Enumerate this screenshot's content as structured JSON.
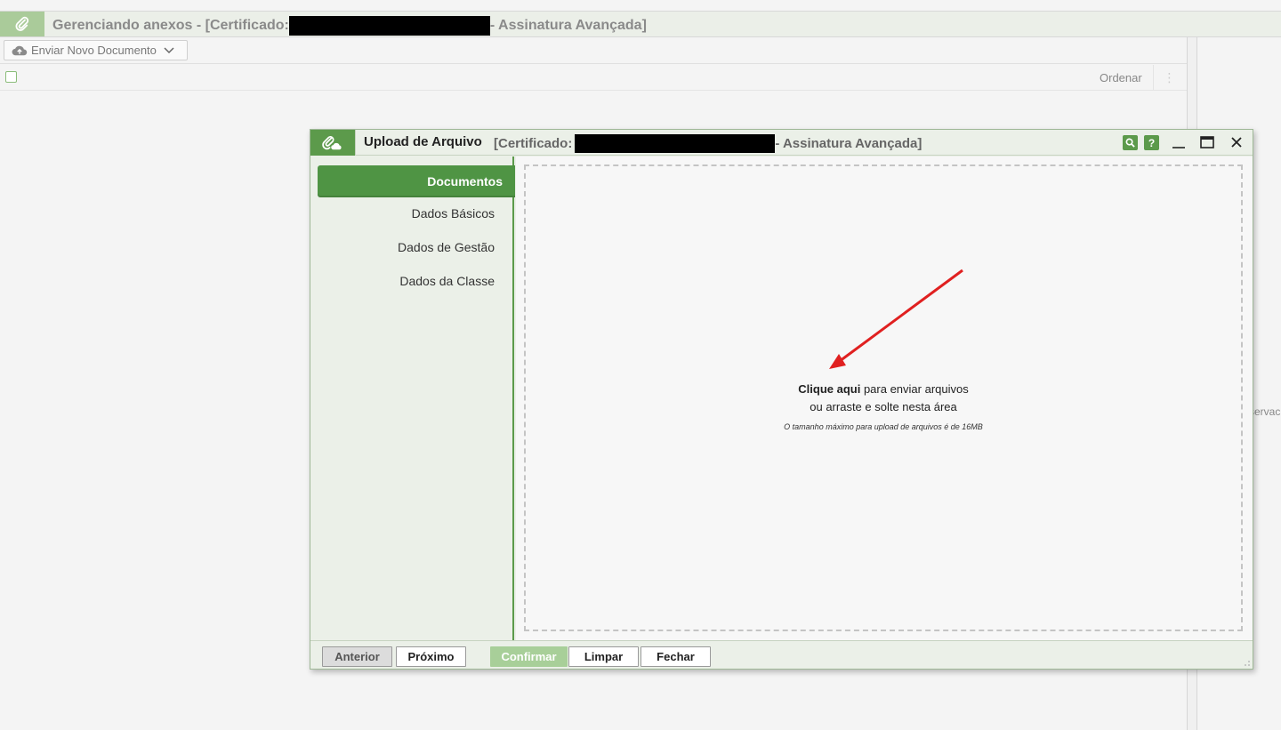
{
  "background_window": {
    "title_prefix": "Gerenciando anexos - [Certificado:",
    "title_suffix": "- Assinatura Avançada]",
    "send_button_label": "Enviar Novo Documento",
    "sort_label": "Ordenar",
    "partial_side_text": "servac"
  },
  "dialog": {
    "title": "Upload de Arquivo",
    "subtitle_prefix": "[Certificado:",
    "subtitle_suffix": "- Assinatura Avançada]",
    "nav": [
      {
        "label": "Documentos",
        "active": true
      },
      {
        "label": "Dados Básicos",
        "active": false
      },
      {
        "label": "Dados de Gestão",
        "active": false
      },
      {
        "label": "Dados da Classe",
        "active": false
      }
    ],
    "dropzone": {
      "link_text": "Clique aqui",
      "line1_rest": " para enviar arquivos",
      "line2": "ou arraste e solte nesta área",
      "hint": "O tamanho máximo para upload de arquivos é de 16MB"
    },
    "footer": {
      "previous": "Anterior",
      "next": "Próximo",
      "confirm": "Confirmar",
      "clear": "Limpar",
      "close": "Fechar"
    }
  },
  "colors": {
    "accent_green": "#4f9444",
    "annotation_arrow": "#e02020"
  }
}
